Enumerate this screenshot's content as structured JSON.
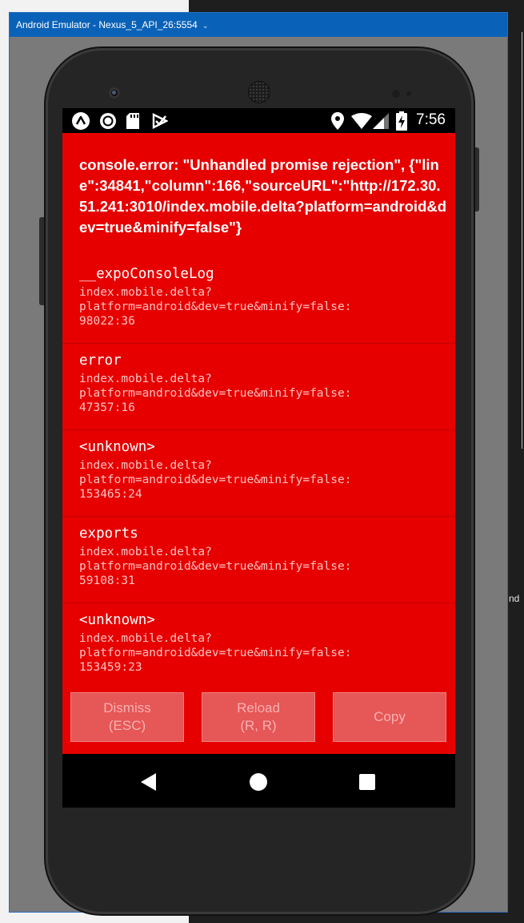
{
  "window": {
    "title": "Android Emulator - Nexus_5_API_26:5554",
    "title_caret": "⌄"
  },
  "background": {
    "right_text": "nd"
  },
  "status_bar": {
    "time": "7:56",
    "icons": [
      "expo-icon",
      "record-icon",
      "sd-card-icon",
      "download-done-icon",
      "location-icon",
      "wifi-icon",
      "signal-icon",
      "battery-charging-icon"
    ]
  },
  "error": {
    "message": "console.error: \"Unhandled promise rejection\", {\"line\":34841,\"column\":166,\"sourceURL\":\"http://172.30.51.241:3010/index.mobile.delta?platform=android&dev=true&minify=false\"}"
  },
  "stack": [
    {
      "name": "__expoConsoleLog",
      "location": "index.mobile.delta?\nplatform=android&dev=true&minify=false:\n98022:36"
    },
    {
      "name": "error",
      "location": "index.mobile.delta?\nplatform=android&dev=true&minify=false:\n47357:16"
    },
    {
      "name": "<unknown>",
      "location": "index.mobile.delta?\nplatform=android&dev=true&minify=false:\n153465:24"
    },
    {
      "name": "exports",
      "location": "index.mobile.delta?\nplatform=android&dev=true&minify=false:\n59108:31"
    },
    {
      "name": "<unknown>",
      "location": "index.mobile.delta?\nplatform=android&dev=true&minify=false:\n153459:23"
    }
  ],
  "buttons": {
    "dismiss": "Dismiss\n(ESC)",
    "reload": "Reload\n(R, R)",
    "copy": "Copy"
  },
  "colors": {
    "redbox": "#e60000",
    "titlebar": "#0a62b8"
  }
}
